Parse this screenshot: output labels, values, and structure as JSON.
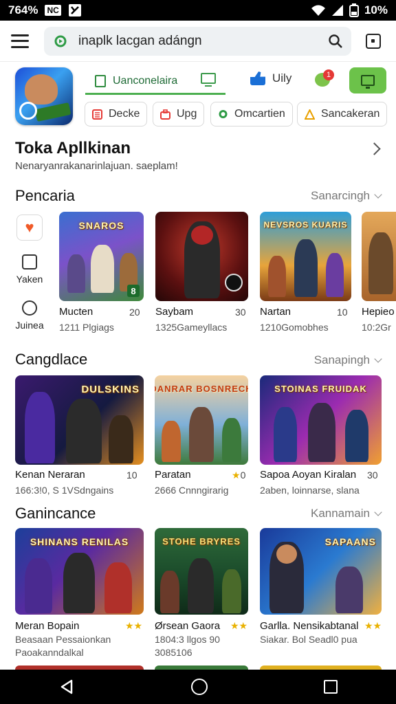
{
  "status_bar": {
    "time": "764%",
    "nc_badge": "NC",
    "battery": "10%"
  },
  "search": {
    "text": "inaplk lacgan adángn"
  },
  "app_tabs": {
    "active_tab": "Uanconelaira",
    "like_label": "Uily",
    "chat_badge": "1"
  },
  "chips": [
    {
      "label": "Decke"
    },
    {
      "label": "Upg"
    },
    {
      "label": "Omcartien"
    },
    {
      "label": "Sancakeran"
    }
  ],
  "page": {
    "title": "Toka Apllkinan",
    "subtitle": "Nenaryanrakanarinlajuan. saeplam!"
  },
  "side_items": [
    {
      "label": "Yaken"
    },
    {
      "label": "Juinea"
    }
  ],
  "sections": [
    {
      "title": "Pencaria",
      "sort": "Sanarcingh",
      "cards": [
        {
          "name": "Mucten",
          "rating": "20",
          "meta": "1211 Plgiags",
          "thumb_text": "SNAROS",
          "badge": "8"
        },
        {
          "name": "Saybam",
          "rating": "30",
          "meta": "1325Gameyllacs",
          "thumb_text": "",
          "badge": ""
        },
        {
          "name": "Nartan",
          "rating": "10",
          "meta": "1210Gomobhes",
          "thumb_text": "NEVSROS KUARIS",
          "badge": ""
        },
        {
          "name": "Hepieo",
          "rating": "",
          "meta": "10:2Gr",
          "thumb_text": "",
          "badge": ""
        }
      ]
    },
    {
      "title": "Cangdlace",
      "sort": "Sanapingh",
      "cards": [
        {
          "name": "Kenan Neraran",
          "rating": "10",
          "meta": "166:3!0, S 1VSdngains",
          "thumb_text": "DULSKINS"
        },
        {
          "name": "Paratan",
          "rating": "0",
          "meta": "2666 Cnnngirarig",
          "thumb_text": "DANRAR BOSNRECH"
        },
        {
          "name": "Sapoa Aoyan Kiralan",
          "rating": "30",
          "meta": "2aben, loinnarse, slana",
          "thumb_text": "STOINAS FRUIDAK"
        }
      ]
    },
    {
      "title": "Ganincance",
      "sort": "Kannamain",
      "cards": [
        {
          "name": "Meran Bopain",
          "rating": "★★",
          "meta_lines": [
            "Beasaan Pessaionkan",
            "Paoakanndalkal"
          ],
          "thumb_text": "SHINANS RENILAS"
        },
        {
          "name": "Ørsean Gaora",
          "rating": "★★",
          "meta_lines": [
            "1804:3 llgos 90",
            "3085106"
          ],
          "thumb_text": "STOHE BRYRES"
        },
        {
          "name": "Garlla. Nensikabtanal",
          "rating": "★★",
          "meta_lines": [
            "Siakar. Bol Seadl0 pua"
          ],
          "thumb_text": "SAPAANS"
        }
      ]
    }
  ],
  "colors": {
    "accent_green": "#4caf50",
    "button_green": "#6cc24a",
    "star": "#e9b100",
    "heart": "#f05a28"
  }
}
